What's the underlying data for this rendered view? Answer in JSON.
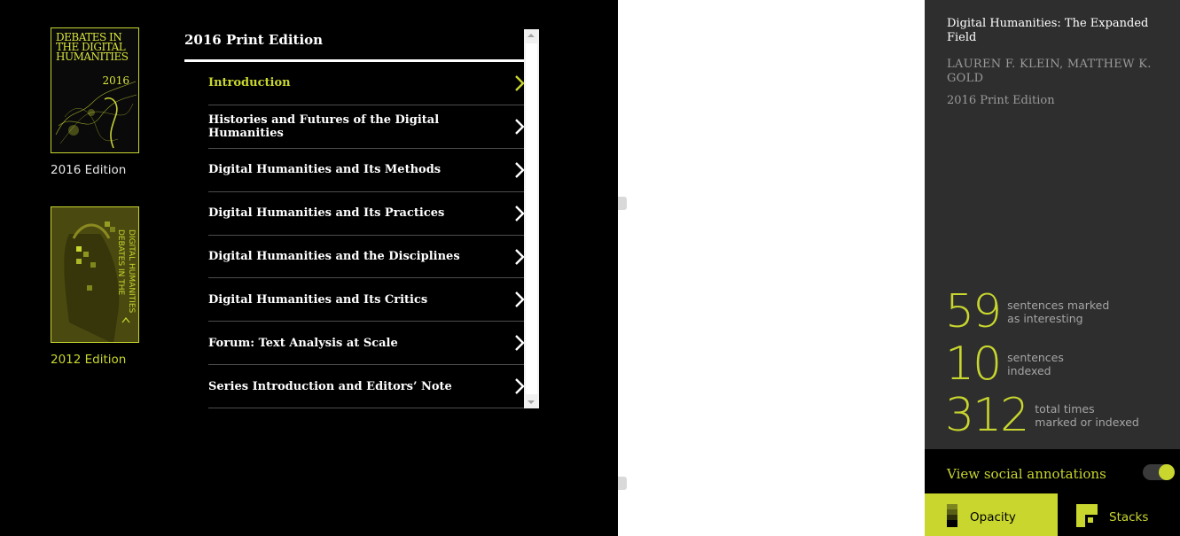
{
  "editions": [
    {
      "label": "2016 Edition",
      "cover_title": "DEBATES IN THE DIGITAL HUMANITIES",
      "cover_year": "2016",
      "active": false
    },
    {
      "label": "2012 Edition",
      "cover_title": "DEBATES IN THE DIGITAL HUMANITIES",
      "active": true
    }
  ],
  "toc": {
    "title": "2016 Print Edition",
    "items": [
      {
        "label": "Introduction",
        "active": true
      },
      {
        "label": "Histories and Futures of the Digital Humanities"
      },
      {
        "label": "Digital Humanities and Its Methods"
      },
      {
        "label": "Digital Humanities and Its Practices"
      },
      {
        "label": "Digital Humanities and the Disciplines"
      },
      {
        "label": "Digital Humanities and Its Critics"
      },
      {
        "label": "Forum: Text Analysis at Scale"
      },
      {
        "label": "Series Introduction and Editors’ Note"
      }
    ]
  },
  "book": {
    "title": "Digital Humanities: The Expanded Field",
    "authors": "LAUREN F. KLEIN, MATTHEW K. GOLD",
    "edition": "2016 Print Edition"
  },
  "stats": [
    {
      "value": "59",
      "label_line1": "sentences marked",
      "label_line2": "as interesting"
    },
    {
      "value": "10",
      "label_line1": "sentences",
      "label_line2": "indexed"
    },
    {
      "value": "312",
      "label_line1": "total times",
      "label_line2": "marked or indexed"
    }
  ],
  "social": {
    "label": "View social annotations",
    "toggle_on": true
  },
  "buttons": {
    "opacity": "Opacity",
    "stacks": "Stacks"
  },
  "colors": {
    "accent": "#c8d62e",
    "panel": "#2e2e2e",
    "background": "#000000"
  }
}
